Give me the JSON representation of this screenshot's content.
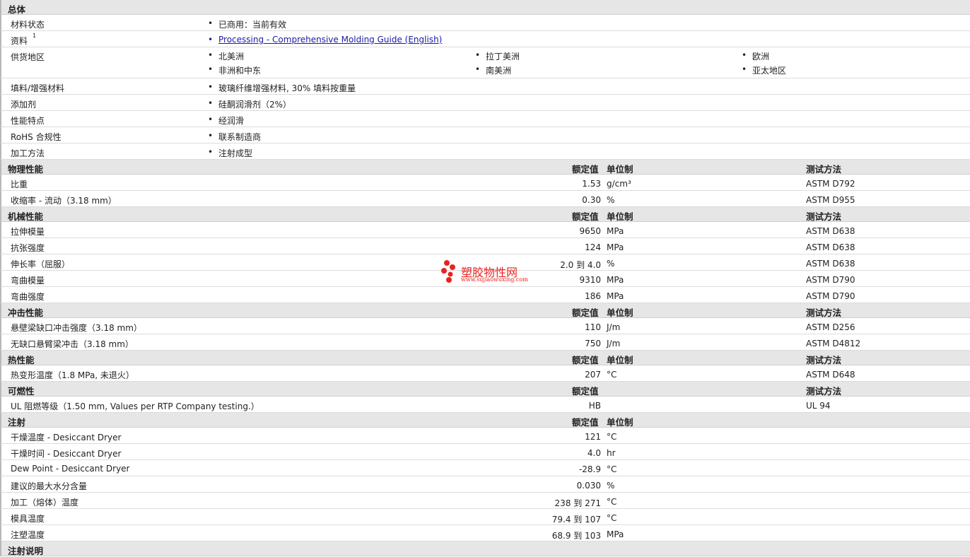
{
  "general": {
    "title": "总体",
    "rows": [
      {
        "label": "材料状态",
        "items": [
          "已商用：当前有效"
        ]
      },
      {
        "label": "资料",
        "sup": "1",
        "link": "Processing - Comprehensive Molding Guide (English)"
      },
      {
        "label": "供货地区",
        "items": [
          "北美洲",
          "拉丁美洲",
          "欧洲",
          "非洲和中东",
          "南美洲",
          "亚太地区"
        ]
      },
      {
        "label": "填料/增强材料",
        "items": [
          "玻璃纤维增强材料, 30% 填料按重量"
        ]
      },
      {
        "label": "添加剂",
        "items": [
          "硅酮润滑剂（2%）"
        ]
      },
      {
        "label": "性能特点",
        "items": [
          "经润滑"
        ]
      },
      {
        "label": "RoHS 合规性",
        "items": [
          "联系制造商"
        ]
      },
      {
        "label": "加工方法",
        "items": [
          "注射成型"
        ]
      }
    ]
  },
  "col_headers": {
    "value": "额定值",
    "unit": "单位制",
    "method": "测试方法"
  },
  "sections": [
    {
      "title": "物理性能",
      "show_unit": true,
      "show_method": true,
      "rows": [
        {
          "label": "比重",
          "value": "1.53",
          "unit": "g/cm³",
          "method": "ASTM D792"
        },
        {
          "label": "收缩率  - 流动（3.18 mm）",
          "value": "0.30",
          "unit": "%",
          "method": "ASTM D955"
        }
      ]
    },
    {
      "title": "机械性能",
      "show_unit": true,
      "show_method": true,
      "rows": [
        {
          "label": "拉伸模量",
          "value": "9650",
          "unit": "MPa",
          "method": "ASTM D638"
        },
        {
          "label": "抗张强度",
          "value": "124",
          "unit": "MPa",
          "method": "ASTM D638"
        },
        {
          "label": "伸长率（屈服）",
          "value": "2.0 到  4.0",
          "unit": "%",
          "method": "ASTM D638"
        },
        {
          "label": "弯曲模量",
          "value": "9310",
          "unit": "MPa",
          "method": "ASTM D790"
        },
        {
          "label": "弯曲强度",
          "value": "186",
          "unit": "MPa",
          "method": "ASTM D790"
        }
      ]
    },
    {
      "title": "冲击性能",
      "show_unit": true,
      "show_method": true,
      "rows": [
        {
          "label": "悬壁梁缺口冲击强度（3.18 mm）",
          "value": "110",
          "unit": "J/m",
          "method": "ASTM D256"
        },
        {
          "label": "无缺口悬臂梁冲击（3.18 mm）",
          "value": "750",
          "unit": "J/m",
          "method": "ASTM D4812"
        }
      ]
    },
    {
      "title": "热性能",
      "show_unit": true,
      "show_method": true,
      "rows": [
        {
          "label": "热变形温度（1.8 MPa, 未退火）",
          "value": "207",
          "unit": "°C",
          "method": "ASTM D648"
        }
      ]
    },
    {
      "title": "可燃性",
      "show_unit": false,
      "show_method": true,
      "rows": [
        {
          "label": "UL 阻燃等级（1.50 mm, Values per RTP Company testing.）",
          "value": "HB",
          "unit": "",
          "method": "UL 94"
        }
      ]
    },
    {
      "title": "注射",
      "show_unit": true,
      "show_method": false,
      "rows": [
        {
          "label": "干燥温度  - Desiccant Dryer",
          "value": "121",
          "unit": "°C",
          "method": ""
        },
        {
          "label": "干燥时间  - Desiccant Dryer",
          "value": "4.0",
          "unit": "hr",
          "method": ""
        },
        {
          "label": "Dew Point - Desiccant Dryer",
          "value": "-28.9",
          "unit": "°C",
          "method": ""
        },
        {
          "label": "建议的最大水分含量",
          "value": "0.030",
          "unit": "%",
          "method": ""
        },
        {
          "label": "加工（熔体）温度",
          "value": "238 到  271",
          "unit": "°C",
          "method": ""
        },
        {
          "label": "模具温度",
          "value": "79.4 到  107",
          "unit": "°C",
          "method": ""
        },
        {
          "label": "注塑温度",
          "value": "68.9 到  103",
          "unit": "MPa",
          "method": ""
        }
      ]
    },
    {
      "title": "注射说明",
      "show_unit": false,
      "show_method": false,
      "rows": []
    }
  ],
  "watermark": {
    "text": "塑胶物性网",
    "url": "www.sujiaowuxing.com",
    "color": "#e8231e"
  }
}
